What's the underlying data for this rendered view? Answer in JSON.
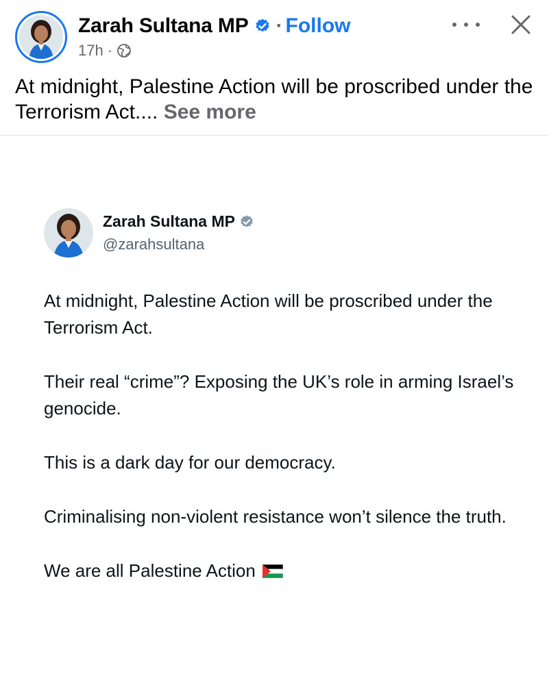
{
  "post": {
    "author": "Zarah Sultana MP",
    "dot": "·",
    "follow_label": "Follow",
    "time": "17h",
    "meta_sep": "·",
    "caption": "At midnight, Palestine Action will be proscribed under the Terrorism Act....",
    "see_more_label": "See more"
  },
  "tweet": {
    "name": "Zarah Sultana MP",
    "handle": "@zarahsultana",
    "paragraphs": [
      "At midnight, Palestine Action will be proscribed under the Terrorism Act.",
      "Their real “crime”? Exposing the UK’s role in arming Israel’s genocide.",
      "This is a dark day for our democracy.",
      "Criminalising non-violent resistance won’t silence the truth.",
      "We are all Palestine Action"
    ]
  },
  "icons": {
    "verified": "verified-badge-icon",
    "globe": "globe-icon",
    "more": "more-icon",
    "close": "close-icon",
    "flag": "palestine-flag-icon"
  },
  "colors": {
    "facebook_blue": "#1877f2",
    "meta_gray": "#65676b",
    "twitter_verified_gray": "#829aab",
    "flag_red": "#e4312b",
    "flag_black": "#000000",
    "flag_green": "#149954"
  }
}
